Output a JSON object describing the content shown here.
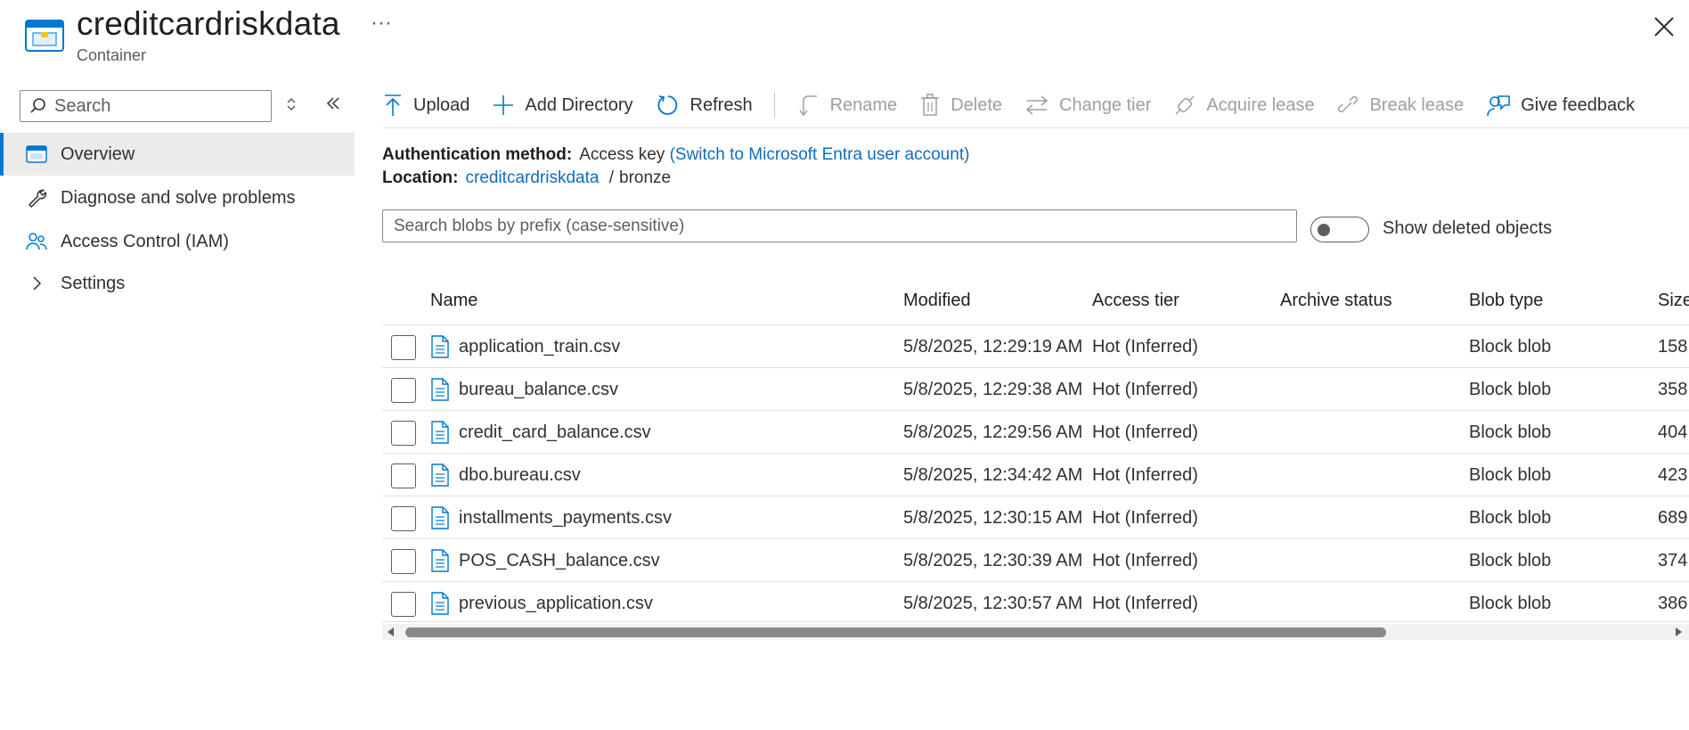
{
  "header": {
    "title": "creditcardriskdata",
    "subtitle": "Container",
    "more_label": "···"
  },
  "sidebar": {
    "search_placeholder": "Search",
    "items": [
      {
        "label": "Overview",
        "icon": "container-icon",
        "active": true
      },
      {
        "label": "Diagnose and solve problems",
        "icon": "wrench-icon"
      },
      {
        "label": "Access Control (IAM)",
        "icon": "people-icon"
      },
      {
        "label": "Settings",
        "icon": "chevron-right-icon"
      }
    ]
  },
  "toolbar": {
    "upload": "Upload",
    "add_directory": "Add Directory",
    "refresh": "Refresh",
    "rename": "Rename",
    "delete": "Delete",
    "change_tier": "Change tier",
    "acquire_lease": "Acquire lease",
    "break_lease": "Break lease",
    "give_feedback": "Give feedback"
  },
  "info": {
    "auth_label": "Authentication method:",
    "auth_value": "Access key",
    "auth_switch": "(Switch to Microsoft Entra user account)",
    "location_label": "Location:",
    "location_link": "creditcardriskdata",
    "location_sep": "/",
    "location_folder": "bronze"
  },
  "filter": {
    "search_placeholder": "Search blobs by prefix (case-sensitive)",
    "show_deleted_label": "Show deleted objects",
    "show_deleted": false
  },
  "table": {
    "columns": {
      "name": "Name",
      "modified": "Modified",
      "access_tier": "Access tier",
      "archive_status": "Archive status",
      "blob_type": "Blob type",
      "size": "Size"
    },
    "rows": [
      {
        "name": "application_train.csv",
        "modified": "5/8/2025, 12:29:19 AM",
        "tier": "Hot (Inferred)",
        "archive": "",
        "type": "Block blob",
        "size": "158."
      },
      {
        "name": "bureau_balance.csv",
        "modified": "5/8/2025, 12:29:38 AM",
        "tier": "Hot (Inferred)",
        "archive": "",
        "type": "Block blob",
        "size": "358."
      },
      {
        "name": "credit_card_balance.csv",
        "modified": "5/8/2025, 12:29:56 AM",
        "tier": "Hot (Inferred)",
        "archive": "",
        "type": "Block blob",
        "size": "404."
      },
      {
        "name": "dbo.bureau.csv",
        "modified": "5/8/2025, 12:34:42 AM",
        "tier": "Hot (Inferred)",
        "archive": "",
        "type": "Block blob",
        "size": "423."
      },
      {
        "name": "installments_payments.csv",
        "modified": "5/8/2025, 12:30:15 AM",
        "tier": "Hot (Inferred)",
        "archive": "",
        "type": "Block blob",
        "size": "689."
      },
      {
        "name": "POS_CASH_balance.csv",
        "modified": "5/8/2025, 12:30:39 AM",
        "tier": "Hot (Inferred)",
        "archive": "",
        "type": "Block blob",
        "size": "374."
      },
      {
        "name": "previous_application.csv",
        "modified": "5/8/2025, 12:30:57 AM",
        "tier": "Hot (Inferred)",
        "archive": "",
        "type": "Block blob",
        "size": "386."
      }
    ]
  },
  "colors": {
    "accent": "#0078d4",
    "link": "#0f6cbd",
    "disabled": "#a19f9d"
  }
}
